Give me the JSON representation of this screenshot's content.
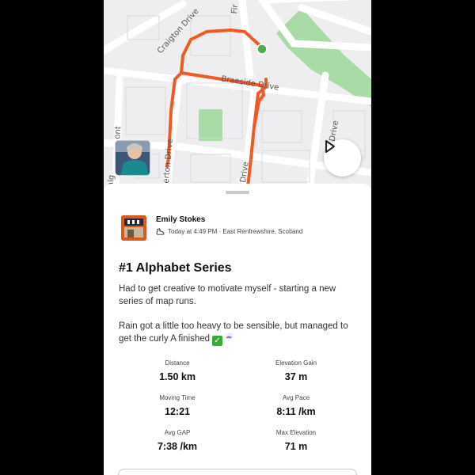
{
  "map": {
    "streets": [
      "Craigton Drive",
      "Braeside Drive",
      "Drive",
      "Drive",
      "Fir",
      "therton Drive",
      "alg",
      "ont"
    ],
    "route_color": "#f05a22",
    "start_marker_color": "#4caf50",
    "park_color": "#a8dba6"
  },
  "athlete": {
    "name": "Emily Stokes",
    "meta": "Today at 4:49 PM · East Renfrewshire, Scotland",
    "activity_icon": "shoe-icon"
  },
  "activity": {
    "title": "#1 Alphabet Series",
    "description_1": "Had to get creative to motivate myself - starting a new series of map runs.",
    "description_2": "Rain got a little too heavy to be sensible, but managed to get the curly A finished",
    "emoji": [
      "check-mark-icon",
      "rain-cloud-icon"
    ]
  },
  "stats": [
    {
      "label": "Distance",
      "value": "1.50 km"
    },
    {
      "label": "Elevation Gain",
      "value": "37 m"
    },
    {
      "label": "Moving Time",
      "value": "12:21"
    },
    {
      "label": "Avg Pace",
      "value": "8:11 /km"
    },
    {
      "label": "Avg GAP",
      "value": "7:38 /km"
    },
    {
      "label": "Max Elevation",
      "value": "71 m"
    }
  ]
}
